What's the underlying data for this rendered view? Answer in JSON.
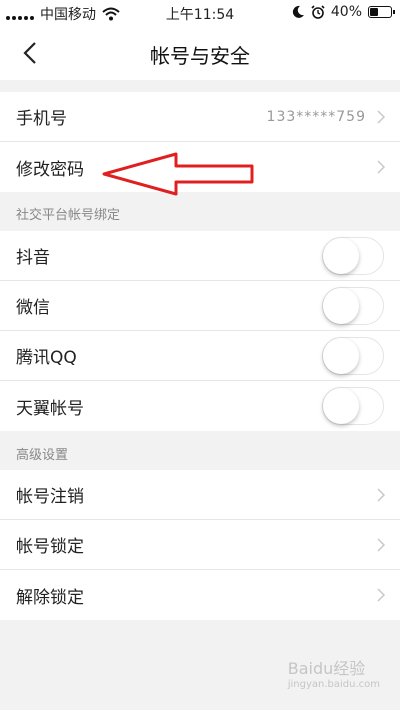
{
  "status_bar": {
    "carrier": "中国移动",
    "time": "上午11:54",
    "battery_percent": "40%",
    "battery_level": 0.4,
    "icons": [
      "signal-icon",
      "wifi-icon",
      "moon-icon",
      "alarm-icon",
      "battery-icon"
    ]
  },
  "nav": {
    "title": "帐号与安全",
    "back_icon": "chevron-left-icon"
  },
  "account": {
    "phone_label": "手机号",
    "phone_value": "133*****759",
    "password_label": "修改密码"
  },
  "social": {
    "header": "社交平台帐号绑定",
    "items": [
      {
        "label": "抖音",
        "enabled": false
      },
      {
        "label": "微信",
        "enabled": false
      },
      {
        "label": "腾讯QQ",
        "enabled": false
      },
      {
        "label": "天翼帐号",
        "enabled": false
      }
    ]
  },
  "advanced": {
    "header": "高级设置",
    "items": [
      {
        "label": "帐号注销"
      },
      {
        "label": "帐号锁定"
      },
      {
        "label": "解除锁定"
      }
    ]
  },
  "annotation": {
    "arrow_color": "#e02020"
  },
  "watermark": {
    "text": "Baidu经验",
    "sub": "jingyan.baidu.com"
  }
}
